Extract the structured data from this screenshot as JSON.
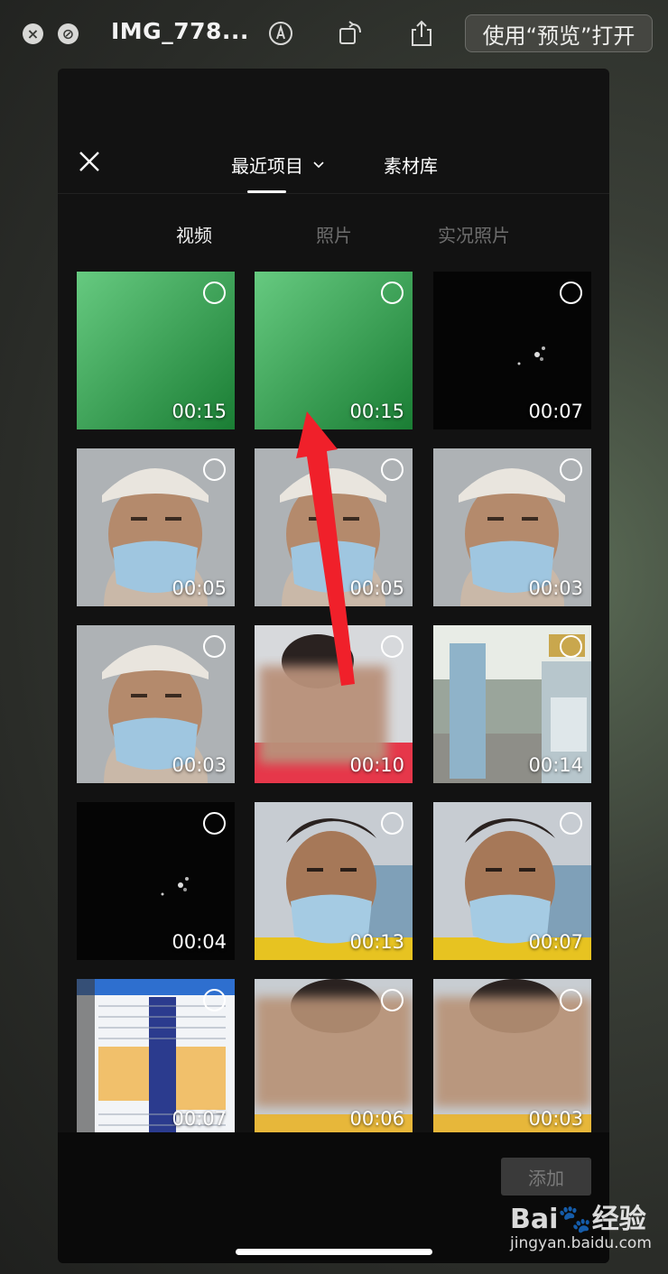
{
  "titlebar": {
    "title": "IMG_778...",
    "close_icon": "×",
    "disabled_icon": "⊘",
    "open_with": "使用“预览”打开"
  },
  "header": {
    "tabs": [
      {
        "label": "最近项目",
        "has_dropdown": true,
        "active": true
      },
      {
        "label": "素材库",
        "active": false
      }
    ],
    "dropdown_icon": "⌄"
  },
  "subtabs": [
    {
      "label": "视频",
      "active": true
    },
    {
      "label": "照片",
      "active": false
    },
    {
      "label": "实况照片",
      "active": false
    }
  ],
  "media": [
    {
      "type": "green",
      "duration": "00:15"
    },
    {
      "type": "green",
      "duration": "00:15"
    },
    {
      "type": "dark",
      "duration": "00:07"
    },
    {
      "type": "face-cap",
      "duration": "00:05"
    },
    {
      "type": "face-cap",
      "duration": "00:05"
    },
    {
      "type": "face-cap",
      "duration": "00:03"
    },
    {
      "type": "face-cap",
      "duration": "00:03"
    },
    {
      "type": "face-blur-red",
      "duration": "00:10"
    },
    {
      "type": "outdoor",
      "duration": "00:14"
    },
    {
      "type": "dark",
      "duration": "00:04"
    },
    {
      "type": "face-outdoor",
      "duration": "00:13"
    },
    {
      "type": "face-outdoor",
      "duration": "00:07"
    },
    {
      "type": "document",
      "duration": "00:07"
    },
    {
      "type": "face-blur",
      "duration": "00:06"
    },
    {
      "type": "face-blur",
      "duration": "00:03"
    }
  ],
  "footer": {
    "add_label": "添加"
  },
  "watermark": {
    "logo": "Bai🐾经验",
    "url": "jingyan.baidu.com"
  },
  "colors": {
    "arrow": "#f0202a",
    "green_screen": "#25b34a",
    "background": "#121212"
  }
}
